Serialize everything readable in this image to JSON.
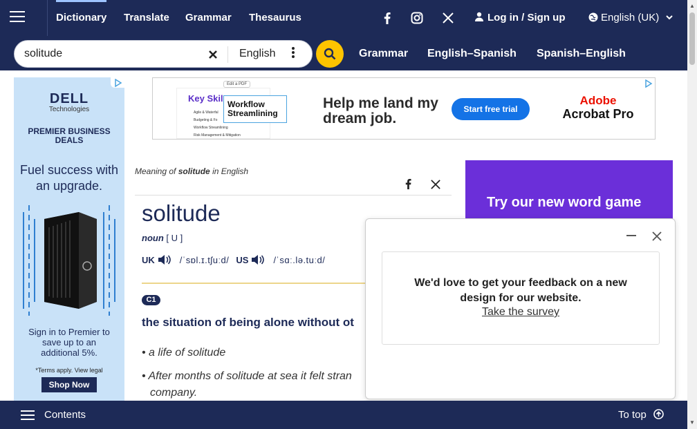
{
  "nav": {
    "items": [
      "Dictionary",
      "Translate",
      "Grammar",
      "Thesaurus"
    ],
    "login": "Log in / Sign up",
    "language": "English (UK)"
  },
  "search": {
    "value": "solitude",
    "dictionary": "English",
    "links": [
      "Grammar",
      "English–Spanish",
      "Spanish–English"
    ]
  },
  "left_ad": {
    "brand": "DELL",
    "brand_sub": "Technologies",
    "headline": "PREMIER BUSINESS DEALS",
    "tagline": "Fuel success with an upgrade.",
    "body": "Sign in to Premier to save up to an additional 5%.",
    "terms": "*Terms apply. View legal",
    "cta": "Shop Now"
  },
  "banner_ad": {
    "badge": "Edit a PDF",
    "card_title": "Key Skil",
    "card_items": [
      "Agile & Waterfal",
      "Budgeting & Fo",
      "Workflow Streamlining",
      "Risk Management & Mitigation"
    ],
    "highlight": "Workflow Streamlining",
    "headline": "Help me land my dream job.",
    "cta": "Start free trial",
    "brand": "Adobe",
    "product": "Acrobat Pro"
  },
  "promo": "Try our new word game",
  "entry": {
    "meaning_prefix": "Meaning of",
    "meaning_word": "solitude",
    "meaning_suffix": "in English",
    "headword": "solitude",
    "pos": "noun",
    "grammar": "[ U ]",
    "uk_label": "UK",
    "uk_ipa": "/ˈsɒl.ɪ.tʃuːd/",
    "us_label": "US",
    "us_ipa": "/ˈsɑː.lə.tuːd/",
    "level": "C1",
    "definition": "the situation of being alone without ot",
    "examples": [
      "a life of solitude",
      "After months of solitude at sea it felt stran",
      "company."
    ]
  },
  "popup": {
    "message": "We'd love to get your feedback on a new design for our website.",
    "link": "Take the survey"
  },
  "bottom": {
    "contents": "Contents",
    "to_top": "To top"
  }
}
